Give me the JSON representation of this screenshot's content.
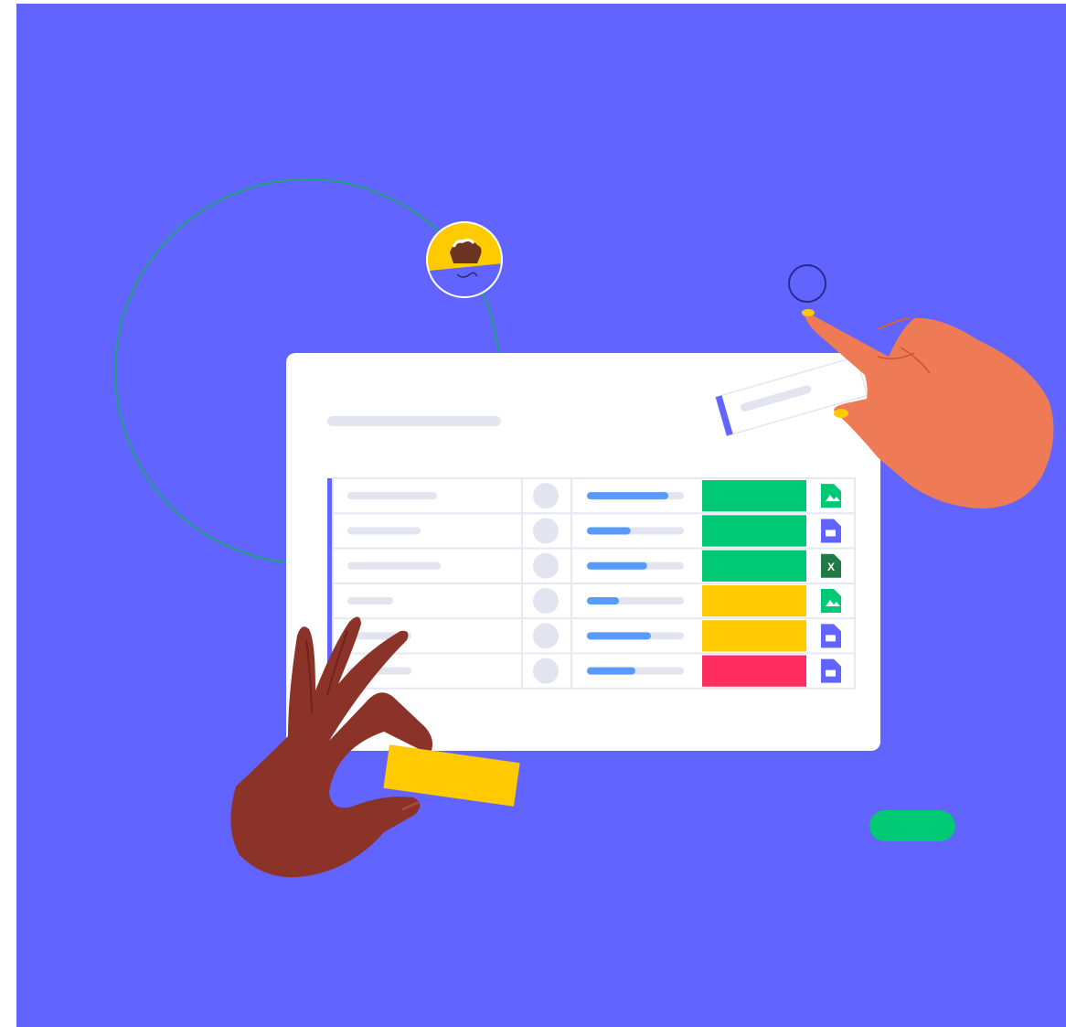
{
  "colors": {
    "background": "#6164ff",
    "board": "#ffffff",
    "row_border": "#e6e9f5",
    "placeholder": "#e2e5f0",
    "progress": "#579bfc",
    "status_green": "#00c875",
    "status_yellow": "#ffcb00",
    "status_red": "#ff2d5f",
    "accent_purple": "#6164ff",
    "orbit_line": "#1fa37a",
    "hand_orange": "#ee7b55",
    "hand_brown": "#8b3329"
  },
  "board": {
    "rows": [
      {
        "progress": 0.84,
        "status": "green",
        "file_icon": "image-file-icon",
        "file_color": "#00c875",
        "file_glyph": ""
      },
      {
        "progress": 0.45,
        "status": "green",
        "file_icon": "doc-file-icon",
        "file_color": "#6164ff",
        "file_glyph": ""
      },
      {
        "progress": 0.62,
        "status": "green",
        "file_icon": "excel-file-icon",
        "file_color": "#1f7a44",
        "file_glyph": "X"
      },
      {
        "progress": 0.33,
        "status": "yellow",
        "file_icon": "image-file-icon",
        "file_color": "#00c875",
        "file_glyph": ""
      },
      {
        "progress": 0.66,
        "status": "yellow",
        "file_icon": "doc-file-icon",
        "file_color": "#6164ff",
        "file_glyph": ""
      },
      {
        "progress": 0.5,
        "status": "red",
        "file_icon": "doc-file-icon",
        "file_color": "#6164ff",
        "file_glyph": ""
      }
    ]
  }
}
